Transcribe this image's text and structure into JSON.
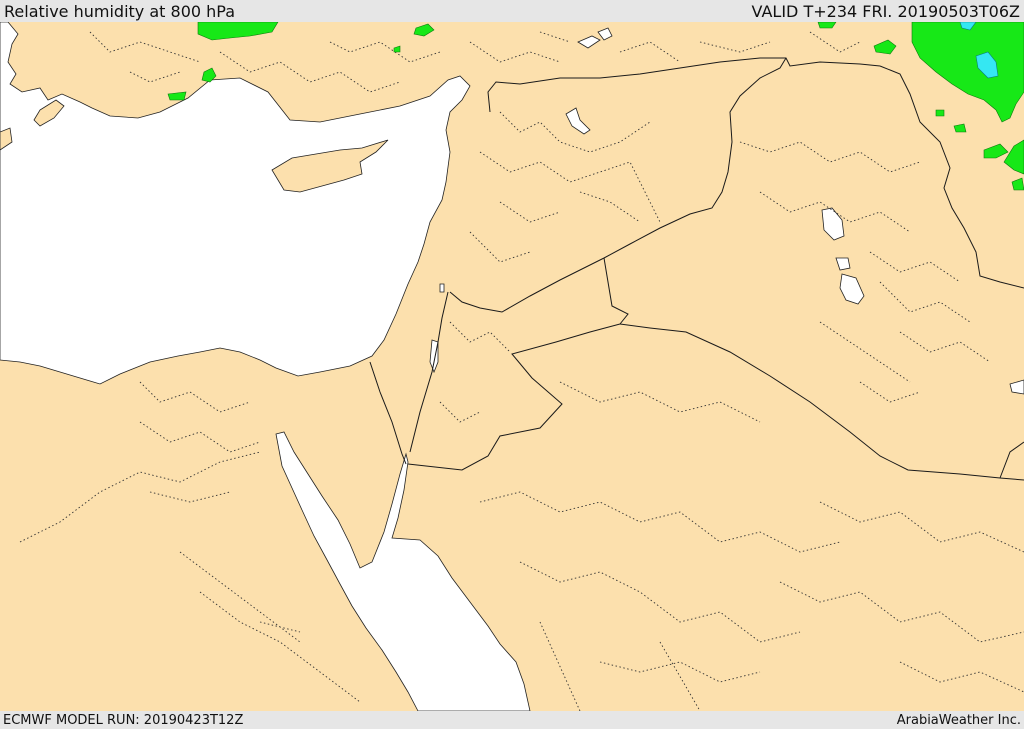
{
  "header": {
    "title": "Relative humidity at 800 hPa",
    "valid": "VALID T+234 FRI. 20190503T06Z"
  },
  "footer": {
    "model_run": "ECMWF MODEL RUN: 20190423T12Z",
    "credit": "ArabiaWeather Inc."
  },
  "colors": {
    "land": "#fce0ad",
    "sea": "#ffffff",
    "humidity_high": "#17e817",
    "humidity_very_high": "#35e7f2",
    "bar": "#e6e6e6"
  },
  "legend": {
    "levels": [
      {
        "color": "#17e817"
      },
      {
        "color": "#35e7f2"
      }
    ]
  }
}
